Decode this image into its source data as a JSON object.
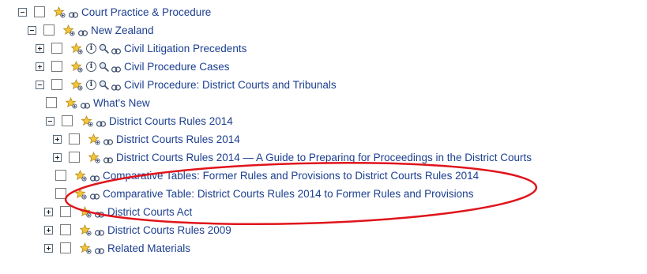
{
  "tree": {
    "rows": [
      {
        "label": "Court Practice & Procedure",
        "toggle": "minus",
        "info": false
      },
      {
        "label": "New Zealand",
        "toggle": "minus",
        "info": false
      },
      {
        "label": "Civil Litigation Precedents",
        "toggle": "plus",
        "info": true
      },
      {
        "label": "Civil Procedure Cases",
        "toggle": "plus",
        "info": true
      },
      {
        "label": "Civil Procedure: District Courts and Tribunals",
        "toggle": "minus",
        "info": true
      },
      {
        "label": "What's New",
        "toggle": "none",
        "info": false
      },
      {
        "label": "District Courts Rules 2014",
        "toggle": "minus",
        "info": false
      },
      {
        "label": "District Courts Rules 2014",
        "toggle": "plus",
        "info": false
      },
      {
        "label": "District Courts Rules 2014 — A Guide to Preparing for Proceedings in the District Courts",
        "toggle": "plus",
        "info": false
      },
      {
        "label": "Comparative Tables: Former Rules and Provisions to District Courts Rules 2014",
        "toggle": "none",
        "info": false
      },
      {
        "label": "Comparative Table: District Courts Rules 2014 to Former Rules and Provisions",
        "toggle": "none",
        "info": false
      },
      {
        "label": "District Courts Act",
        "toggle": "plus",
        "info": false
      },
      {
        "label": "District Courts Rules 2009",
        "toggle": "plus",
        "info": false
      },
      {
        "label": "Related Materials",
        "toggle": "plus",
        "info": false
      }
    ]
  },
  "icons": {
    "info_glyph": "i",
    "star": "add-to-favorites-icon",
    "search": "search-icon",
    "link": "link-icon"
  },
  "colors": {
    "link_text": "#1c3f8f",
    "highlight_ellipse": "#e0141c",
    "star_fill": "#f2c53a"
  }
}
